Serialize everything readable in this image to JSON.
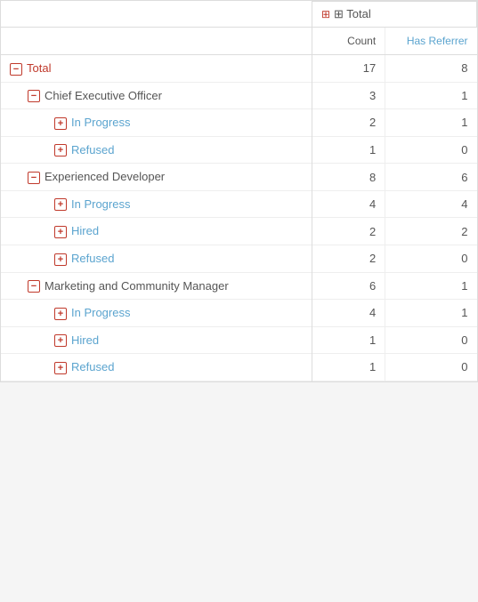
{
  "header": {
    "total_group_label": "⊞ Total",
    "col_count": "Count",
    "col_referrer": "Has Referrer"
  },
  "rows": [
    {
      "type": "total",
      "icon": "collapse",
      "label": "Total",
      "count": "17",
      "referrer": "8",
      "indent": 0
    },
    {
      "type": "group",
      "icon": "collapse",
      "label": "Chief Executive Officer",
      "count": "3",
      "referrer": "1",
      "indent": 1
    },
    {
      "type": "sub",
      "icon": "expand",
      "label": "In Progress",
      "count": "2",
      "referrer": "1",
      "indent": 2
    },
    {
      "type": "sub",
      "icon": "expand",
      "label": "Refused",
      "count": "1",
      "referrer": "0",
      "indent": 2
    },
    {
      "type": "group",
      "icon": "collapse",
      "label": "Experienced Developer",
      "count": "8",
      "referrer": "6",
      "indent": 1
    },
    {
      "type": "sub",
      "icon": "expand",
      "label": "In Progress",
      "count": "4",
      "referrer": "4",
      "indent": 2
    },
    {
      "type": "sub",
      "icon": "expand",
      "label": "Hired",
      "count": "2",
      "referrer": "2",
      "indent": 2
    },
    {
      "type": "sub",
      "icon": "expand",
      "label": "Refused",
      "count": "2",
      "referrer": "0",
      "indent": 2
    },
    {
      "type": "group",
      "icon": "collapse",
      "label": "Marketing and Community Manager",
      "count": "6",
      "referrer": "1",
      "indent": 1
    },
    {
      "type": "sub",
      "icon": "expand",
      "label": "In Progress",
      "count": "4",
      "referrer": "1",
      "indent": 2
    },
    {
      "type": "sub",
      "icon": "expand",
      "label": "Hired",
      "count": "1",
      "referrer": "0",
      "indent": 2
    },
    {
      "type": "sub",
      "icon": "expand",
      "label": "Refused",
      "count": "1",
      "referrer": "0",
      "indent": 2
    }
  ]
}
